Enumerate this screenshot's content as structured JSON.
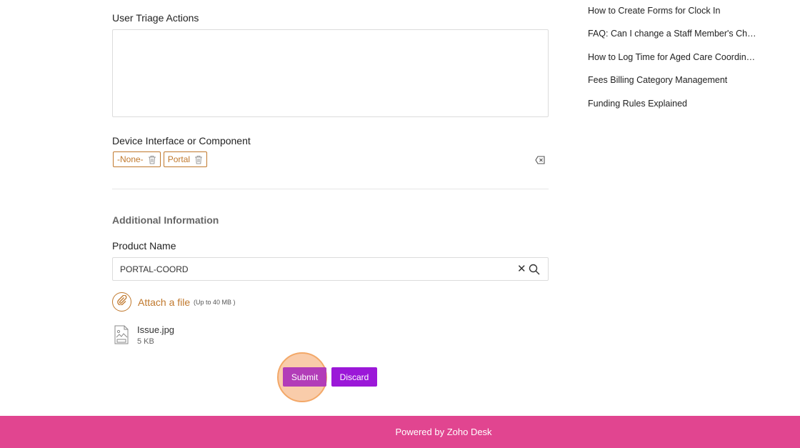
{
  "form": {
    "triage_label": "User Triage Actions",
    "triage_value": "",
    "device_label": "Device Interface or Component",
    "device_tags": [
      "-None-",
      "Portal"
    ],
    "additional_heading": "Additional Information",
    "product_label": "Product Name",
    "product_value": "PORTAL-COORD",
    "attach_label": "Attach a file",
    "attach_limit": "(Up to 40 MB )",
    "attachment": {
      "name": "Issue.jpg",
      "size": "5 KB"
    },
    "submit_label": "Submit",
    "discard_label": "Discard"
  },
  "sidebar": {
    "articles": [
      "How to Create Forms for Clock In",
      "FAQ: Can I change a Staff Member's Check In Settings?",
      "How to Log Time for Aged Care Coordination",
      "Fees Billing Category Management",
      "Funding Rules Explained"
    ]
  },
  "footer": {
    "text": "Powered by Zoho Desk"
  },
  "colors": {
    "accent": "#c0782c",
    "submit": "#b23db8",
    "discard": "#9b18d8",
    "footer": "#e14590"
  }
}
